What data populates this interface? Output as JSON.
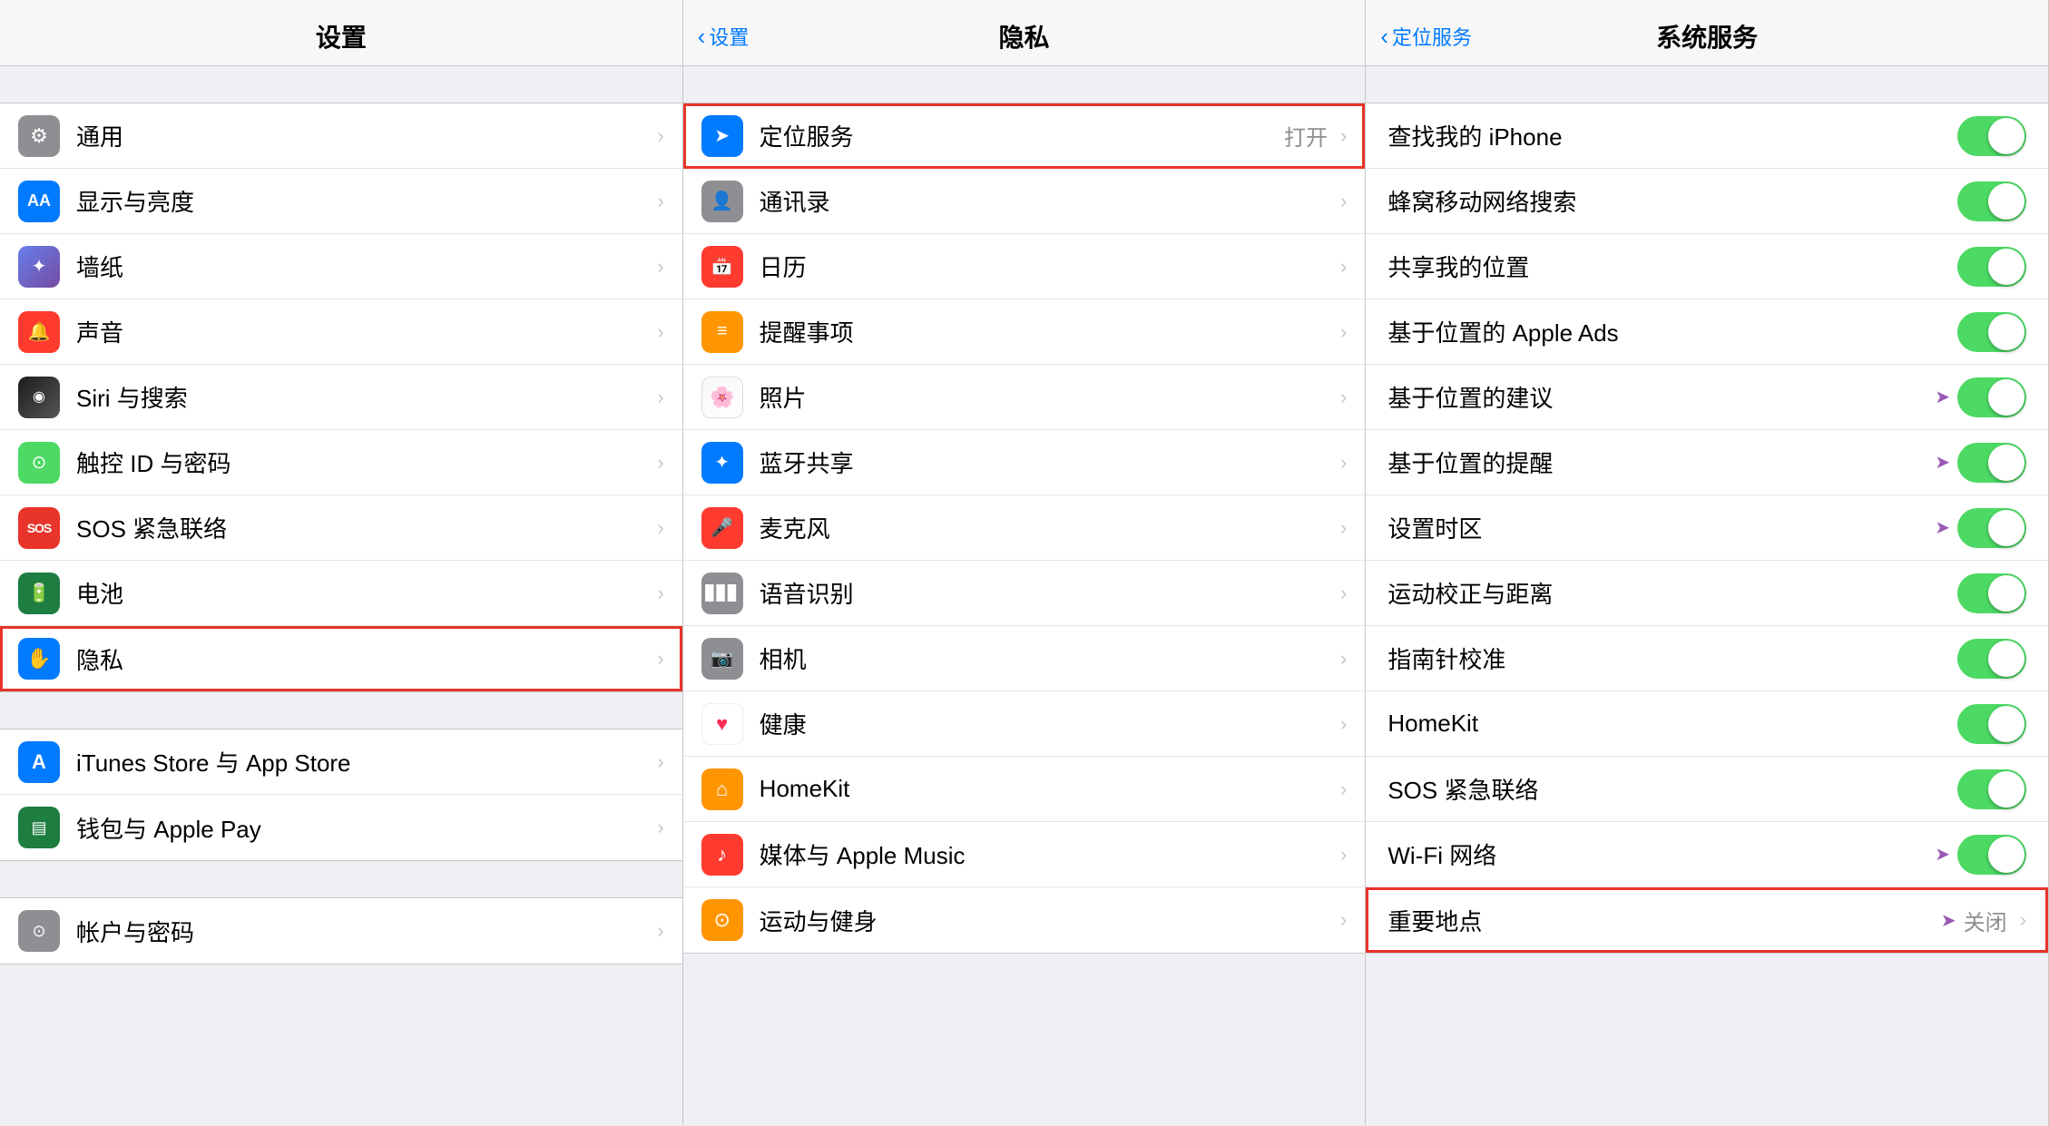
{
  "panels": {
    "left": {
      "title": "设置",
      "sections": [
        {
          "items": [
            {
              "id": "general",
              "label": "通用",
              "iconBg": "bg-gray",
              "iconSymbol": "⚙️",
              "iconUnicode": "⚙",
              "hasChevron": true
            },
            {
              "id": "display",
              "label": "显示与亮度",
              "iconBg": "bg-blue",
              "iconSymbol": "AA",
              "hasChevron": true
            },
            {
              "id": "wallpaper",
              "label": "墙纸",
              "iconBg": "bg-wallpaper",
              "iconSymbol": "✦",
              "hasChevron": true
            },
            {
              "id": "sounds",
              "label": "声音",
              "iconBg": "bg-red",
              "iconSymbol": "🔔",
              "hasChevron": true
            },
            {
              "id": "siri",
              "label": "Siri 与搜索",
              "iconBg": "bg-siri",
              "iconSymbol": "◉",
              "hasChevron": true
            },
            {
              "id": "touchid",
              "label": "触控 ID 与密码",
              "iconBg": "bg-green",
              "iconSymbol": "⊙",
              "hasChevron": true
            },
            {
              "id": "sos",
              "label": "SOS 紧急联络",
              "iconBg": "bg-sos",
              "iconSymbol": "SOS",
              "hasChevron": true
            },
            {
              "id": "battery",
              "label": "电池",
              "iconBg": "bg-dark-green",
              "iconSymbol": "▬",
              "hasChevron": true
            },
            {
              "id": "privacy",
              "label": "隐私",
              "iconBg": "bg-blue",
              "iconSymbol": "✋",
              "hasChevron": true,
              "selected": true
            }
          ]
        },
        {
          "items": [
            {
              "id": "itunes",
              "label": "iTunes Store 与 App Store",
              "iconBg": "bg-blue",
              "iconSymbol": "A",
              "hasChevron": true
            },
            {
              "id": "wallet",
              "label": "钱包与 Apple Pay",
              "iconBg": "bg-dark-green",
              "iconSymbol": "▤",
              "hasChevron": true
            }
          ]
        },
        {
          "items": [
            {
              "id": "account",
              "label": "帐户与密码",
              "iconBg": "bg-gray",
              "iconSymbol": "⊙",
              "hasChevron": true
            }
          ]
        }
      ]
    },
    "middle": {
      "backLabel": "设置",
      "title": "隐私",
      "items": [
        {
          "id": "location",
          "label": "定位服务",
          "status": "打开",
          "iconBg": "bg-location",
          "iconSymbol": "➤",
          "hasChevron": true,
          "selected": true
        },
        {
          "id": "contacts",
          "label": "通讯录",
          "iconBg": "bg-gray",
          "iconSymbol": "👤",
          "hasChevron": true
        },
        {
          "id": "calendar",
          "label": "日历",
          "iconBg": "bg-red",
          "iconSymbol": "📅",
          "hasChevron": true
        },
        {
          "id": "reminders",
          "label": "提醒事项",
          "iconBg": "bg-orange",
          "iconSymbol": "≡",
          "hasChevron": true
        },
        {
          "id": "photos",
          "label": "照片",
          "iconBg": "bg-wallpaper",
          "iconSymbol": "✿",
          "hasChevron": true
        },
        {
          "id": "bluetooth",
          "label": "蓝牙共享",
          "iconBg": "bg-blue",
          "iconSymbol": "✦",
          "hasChevron": true
        },
        {
          "id": "microphone",
          "label": "麦克风",
          "iconBg": "bg-red",
          "iconSymbol": "🎤",
          "hasChevron": true
        },
        {
          "id": "speech",
          "label": "语音识别",
          "iconBg": "bg-gray",
          "iconSymbol": "▊",
          "hasChevron": true
        },
        {
          "id": "camera",
          "label": "相机",
          "iconBg": "bg-gray",
          "iconSymbol": "📷",
          "hasChevron": true
        },
        {
          "id": "health",
          "label": "健康",
          "iconBg": "bg-pink",
          "iconSymbol": "♥",
          "hasChevron": true
        },
        {
          "id": "homekit",
          "label": "HomeKit",
          "iconBg": "bg-orange",
          "iconSymbol": "⌂",
          "hasChevron": true
        },
        {
          "id": "media",
          "label": "媒体与 Apple Music",
          "iconBg": "bg-red",
          "iconSymbol": "♪",
          "hasChevron": true
        },
        {
          "id": "motion",
          "label": "运动与健身",
          "iconBg": "bg-orange",
          "iconSymbol": "⊙",
          "hasChevron": true
        }
      ]
    },
    "right": {
      "backLabel": "定位服务",
      "title": "系统服务",
      "items": [
        {
          "id": "find-iphone",
          "label": "查找我的 iPhone",
          "toggleOn": true,
          "hasLocArrow": false
        },
        {
          "id": "cellular",
          "label": "蜂窝移动网络搜索",
          "toggleOn": true,
          "hasLocArrow": false
        },
        {
          "id": "share-location",
          "label": "共享我的位置",
          "toggleOn": true,
          "hasLocArrow": false
        },
        {
          "id": "apple-ads",
          "label": "基于位置的 Apple Ads",
          "toggleOn": true,
          "hasLocArrow": false
        },
        {
          "id": "suggestions",
          "label": "基于位置的建议",
          "toggleOn": true,
          "hasLocArrow": true
        },
        {
          "id": "reminders-loc",
          "label": "基于位置的提醒",
          "toggleOn": true,
          "hasLocArrow": true
        },
        {
          "id": "timezone",
          "label": "设置时区",
          "toggleOn": true,
          "hasLocArrow": true
        },
        {
          "id": "motion-cal",
          "label": "运动校正与距离",
          "toggleOn": true,
          "hasLocArrow": false
        },
        {
          "id": "compass",
          "label": "指南针校准",
          "toggleOn": true,
          "hasLocArrow": false
        },
        {
          "id": "homekit-r",
          "label": "HomeKit",
          "toggleOn": true,
          "hasLocArrow": false
        },
        {
          "id": "sos-r",
          "label": "SOS 紧急联络",
          "toggleOn": true,
          "hasLocArrow": false
        },
        {
          "id": "wifi-network",
          "label": "Wi-Fi 网络",
          "toggleOn": true,
          "hasLocArrow": true
        },
        {
          "id": "important-places",
          "label": "重要地点",
          "status": "关闭",
          "toggleOn": false,
          "hasLocArrow": true,
          "selected": true
        }
      ]
    }
  }
}
